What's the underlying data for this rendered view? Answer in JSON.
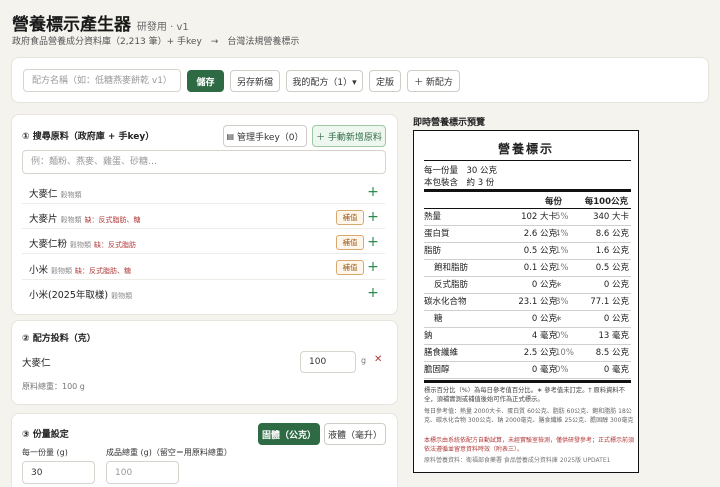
{
  "header": {
    "title": "營養標示產生器",
    "badge": "研發用 · v1",
    "subtitle": "政府食品營養成分資料庫（2,213 筆）+ 手key　→　台灣法規營養標示"
  },
  "toolbar": {
    "recipe_placeholder": "配方名稱（如：低糖燕麥餅乾 v1）",
    "save_label": "儲存",
    "save_as_label": "另存新檔",
    "my_recipes_label": "我的配方（1）▾",
    "finalize_label": "定版",
    "new_recipe_label": "＋ 新配方"
  },
  "search": {
    "section_title": "① 搜尋原料（政府庫 + 手key）",
    "manage_label": "管理手key（0）",
    "add_manual_label": "＋ 手動新增原料",
    "placeholder": "例：麵粉、燕麥、雞蛋、砂糖…",
    "fill_label": "補值",
    "results": [
      {
        "name": "大麥仁",
        "tag": "穀物類",
        "missing": ""
      },
      {
        "name": "大麥片",
        "tag": "穀物類",
        "missing": "缺：反式脂肪、糖"
      },
      {
        "name": "大麥仁粉",
        "tag": "穀物類",
        "missing": "缺：反式脂肪"
      },
      {
        "name": "小米",
        "tag": "穀物類",
        "missing": "缺：反式脂肪、糖"
      },
      {
        "name": "小米(2025年取樣)",
        "tag": "穀物類",
        "missing": ""
      }
    ]
  },
  "recipe": {
    "section_title": "② 配方投料（克）",
    "item_name": "大麥仁",
    "item_qty": "100",
    "unit": "g",
    "remove": "✕",
    "total": "原料總重：100 g"
  },
  "serving": {
    "section_title": "③ 份量設定",
    "solid_label": "固體（公克）",
    "liquid_label": "液體（毫升）",
    "per_serving_label": "每一份量 (g)",
    "per_serving_value": "30",
    "product_weight_label": "成品總重 (g)（留空＝用原料總重）",
    "product_weight_placeholder": "100"
  },
  "preview": {
    "title": "即時營養標示預覽",
    "label_title": "營養標示",
    "serving_size": "每一份量　30 公克",
    "servings_per_pack": "本包裝含　約 3 份",
    "col_per_serving": "每份",
    "col_per_100": "每100公克",
    "rows": [
      {
        "name": "熱量",
        "value": "102 大卡",
        "pct": "5%",
        "per100": "340 大卡",
        "sub": false
      },
      {
        "name": "蛋白質",
        "value": "2.6 公克",
        "pct": "4%",
        "per100": "8.6 公克",
        "sub": false
      },
      {
        "name": "脂肪",
        "value": "0.5 公克",
        "pct": "1%",
        "per100": "1.6 公克",
        "sub": false
      },
      {
        "name": "飽和脂肪",
        "value": "0.1 公克",
        "pct": "1%",
        "per100": "0.5 公克",
        "sub": true
      },
      {
        "name": "反式脂肪",
        "value": "0 公克",
        "pct": "∗",
        "per100": "0 公克",
        "sub": true
      },
      {
        "name": "碳水化合物",
        "value": "23.1 公克",
        "pct": "8%",
        "per100": "77.1 公克",
        "sub": false
      },
      {
        "name": "糖",
        "value": "0 公克",
        "pct": "∗",
        "per100": "0 公克",
        "sub": true
      },
      {
        "name": "鈉",
        "value": "4 毫克",
        "pct": "0%",
        "per100": "13 毫克",
        "sub": false
      },
      {
        "name": "膳食纖維",
        "value": "2.5 公克",
        "pct": "10%",
        "per100": "8.5 公克",
        "sub": false
      },
      {
        "name": "膽固醇",
        "value": "0 毫克",
        "pct": "0%",
        "per100": "0 毫克",
        "sub": false
      }
    ],
    "note1": "標示百分比（%）為每日參考值百分比。∗ 參考值未訂定。† 原料資料不全，須補實測或補值後始可作為正式標示。",
    "note2": "每日參考值：熱量 2000大卡、蛋白質 60公克、脂肪 60公克、飽和脂肪 18公克、碳水化合物 300公克、鈉 2000毫克、膳食纖維 25公克、膽固醇 300毫克",
    "note3": "本標示由系統依配方自動試算，未經實驗室檢測，僅供研發參考；正式標示前須依法遵循並留意資料時效（附表三）。",
    "note4": "原料營養資料：衛福部食藥署 食品營養成分資料庫 2025版 UPDATE1"
  },
  "colors": {
    "accent": "#2e6b45",
    "warn": "#b23a3a",
    "fill_badge": "#d8a86e"
  }
}
